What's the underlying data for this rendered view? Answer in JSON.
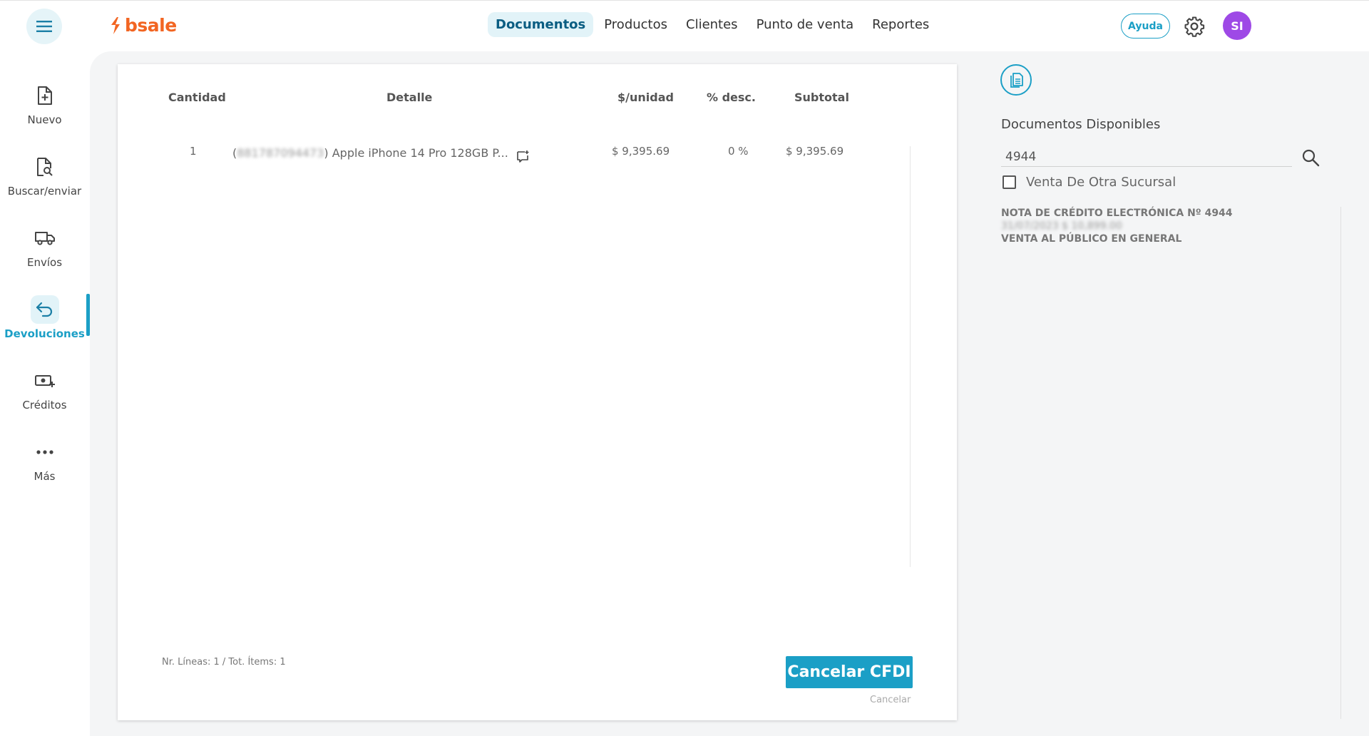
{
  "brand": {
    "name": "bsale",
    "color": "#f26522",
    "accent": "#1b9fc6"
  },
  "topnav": {
    "items": [
      {
        "label": "Documentos",
        "active": true
      },
      {
        "label": "Productos",
        "active": false
      },
      {
        "label": "Clientes",
        "active": false
      },
      {
        "label": "Punto de venta",
        "active": false
      },
      {
        "label": "Reportes",
        "active": false
      }
    ],
    "help_label": "Ayuda",
    "avatar_initials": "SI",
    "avatar_color": "#9e49e6"
  },
  "sidebar": {
    "items": [
      {
        "label": "Nuevo",
        "icon": "file-plus-icon"
      },
      {
        "label": "Buscar/enviar",
        "icon": "file-search-icon"
      },
      {
        "label": "Envíos",
        "icon": "truck-icon"
      },
      {
        "label": "Devoluciones",
        "icon": "return-arrow-icon",
        "active": true
      },
      {
        "label": "Créditos",
        "icon": "cash-plus-icon"
      },
      {
        "label": "Más",
        "icon": "more-dots-icon"
      }
    ]
  },
  "table": {
    "headers": [
      "Cantidad",
      "Detalle",
      "$/unidad",
      "% desc.",
      "Subtotal"
    ],
    "rows": [
      {
        "quantity": "1",
        "code_blurred": "881787094473",
        "detail": ") Apple iPhone 14 Pro 128GB P...",
        "unit_price": "$ 9,395.69",
        "discount": "0 %",
        "subtotal": "$ 9,395.69"
      }
    ]
  },
  "footer": {
    "info": "Nr. Líneas: 1 / Tot. Ítems: 1",
    "primary_button": "Cancelar CFDI",
    "cancel_link": "Cancelar"
  },
  "panel": {
    "title": "Documentos Disponibles",
    "search_value": "4944",
    "checkbox_label": "Venta De Otra Sucursal",
    "results": [
      {
        "title": "NOTA DE CRÉDITO ELECTRÓNICA Nº 4944",
        "date_blurred": "31/07/2023 $ 10,899.00",
        "client": "VENTA AL PÚBLICO EN GENERAL"
      }
    ]
  }
}
